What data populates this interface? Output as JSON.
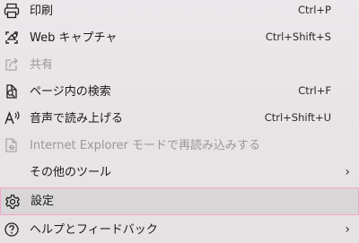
{
  "menu": {
    "items": [
      {
        "label": "印刷",
        "shortcut": "Ctrl+P",
        "icon": "printer-icon",
        "enabled": true
      },
      {
        "label": "Web キャプチャ",
        "shortcut": "Ctrl+Shift+S",
        "icon": "web-capture-icon",
        "enabled": true
      },
      {
        "label": "共有",
        "shortcut": "",
        "icon": "share-icon",
        "enabled": false
      },
      {
        "label": "ページ内の検索",
        "shortcut": "Ctrl+F",
        "icon": "find-in-page-icon",
        "enabled": true
      },
      {
        "label": "音声で読み上げる",
        "shortcut": "Ctrl+Shift+U",
        "icon": "read-aloud-icon",
        "enabled": true
      },
      {
        "label": "Internet Explorer モードで再読み込みする",
        "shortcut": "",
        "icon": "ie-mode-icon",
        "enabled": false
      },
      {
        "label": "その他のツール",
        "shortcut": "",
        "icon": "",
        "enabled": true,
        "submenu": true
      },
      {
        "label": "設定",
        "shortcut": "",
        "icon": "gear-icon",
        "enabled": true,
        "selected": true
      },
      {
        "label": "ヘルプとフィードバック",
        "shortcut": "",
        "icon": "help-icon",
        "enabled": true,
        "submenu": true
      }
    ],
    "chevron": "›",
    "highlight_color": "#f2a6cc"
  }
}
